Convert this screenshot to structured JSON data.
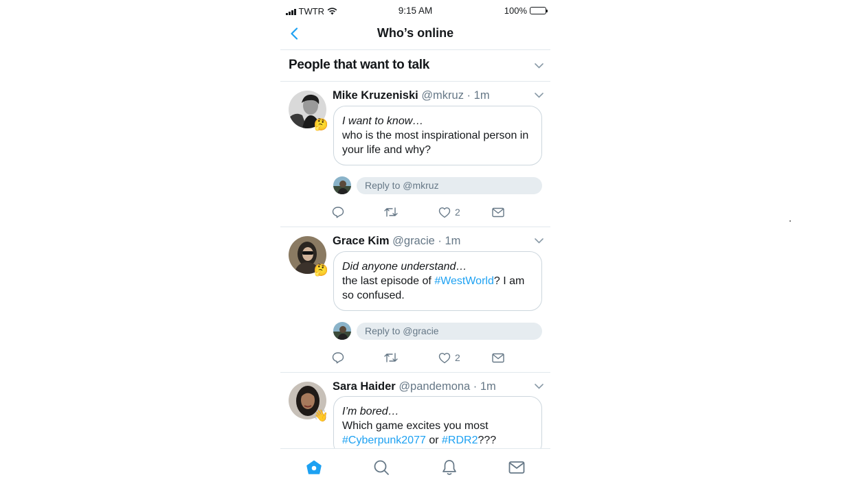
{
  "status_bar": {
    "carrier": "TWTR",
    "time": "9:15 AM",
    "battery": "100%"
  },
  "header": {
    "title": "Who’s online"
  },
  "section": {
    "label": "People that want to talk"
  },
  "tweets": [
    {
      "name": "Mike Kruzeniski",
      "meta": "@mkruz · 1m",
      "emoji": "🤔",
      "prompt": "I want to know…",
      "body": [
        {
          "text": "who is the most inspirational person in your life and why?",
          "tag": false
        }
      ],
      "reply_placeholder": "Reply to @mkruz",
      "likes": "2"
    },
    {
      "name": "Grace Kim",
      "meta": "@gracie · 1m",
      "emoji": "🤔",
      "prompt": "Did anyone understand…",
      "body": [
        {
          "text": "the last episode of ",
          "tag": false
        },
        {
          "text": "#WestWorld",
          "tag": true
        },
        {
          "text": "? I am so confused.",
          "tag": false
        }
      ],
      "reply_placeholder": "Reply to @gracie",
      "likes": "2"
    },
    {
      "name": "Sara Haider",
      "meta": "@pandemona · 1m",
      "emoji": "👋",
      "prompt": "I’m bored…",
      "body": [
        {
          "text": "Which game excites you most ",
          "tag": false
        },
        {
          "text": "#Cyberpunk2077",
          "tag": true
        },
        {
          "text": " or ",
          "tag": false
        },
        {
          "text": "#RDR2",
          "tag": true
        },
        {
          "text": "???",
          "tag": false
        }
      ]
    }
  ],
  "colors": {
    "accent": "#1da1f2",
    "muted": "#657786",
    "divider": "#e1e8ed",
    "reply_bg": "#e6ecf0"
  },
  "icons": [
    "chevron-left-icon",
    "chevron-down-icon",
    "reply-icon",
    "retweet-icon",
    "heart-icon",
    "envelope-icon",
    "home-icon",
    "search-icon",
    "bell-icon"
  ]
}
